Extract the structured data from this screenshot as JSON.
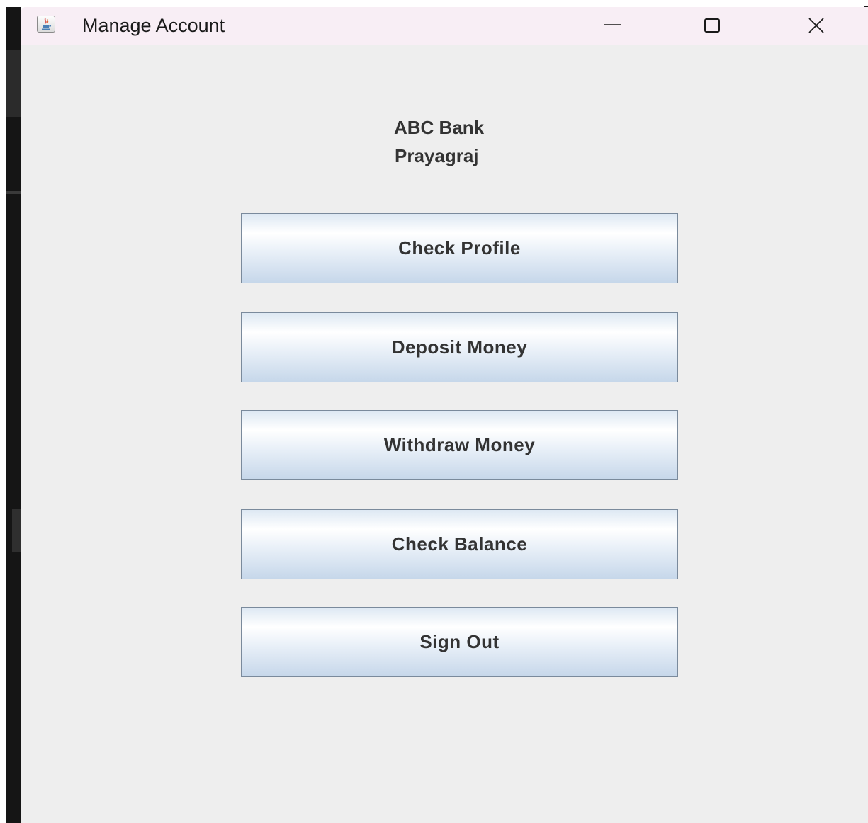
{
  "window": {
    "title": "Manage Account",
    "icon": "java-cup-icon",
    "controls": {
      "minimize": "minimize-icon",
      "maximize": "maximize-icon",
      "close": "close-icon"
    }
  },
  "header": {
    "bank_name": "ABC Bank",
    "branch": "Prayagraj"
  },
  "menu": {
    "buttons": [
      {
        "label": "Check Profile"
      },
      {
        "label": "Deposit Money"
      },
      {
        "label": "Withdraw Money"
      },
      {
        "label": "Check Balance"
      },
      {
        "label": "Sign Out"
      }
    ]
  },
  "colors": {
    "titlebar_bg": "#f8eef5",
    "window_bg": "#eeeeee",
    "text": "#333333",
    "button_gradient_top": "#ffffff",
    "button_gradient_bottom": "#c6d7ea"
  }
}
